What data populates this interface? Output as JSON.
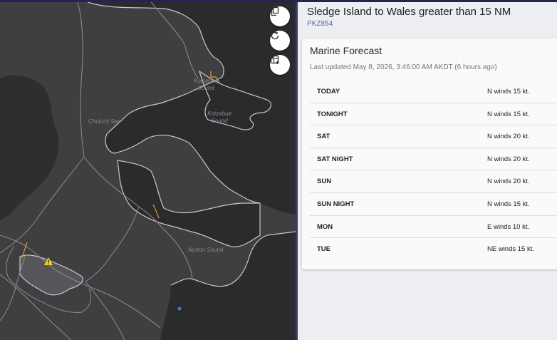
{
  "map": {
    "labels": {
      "chukchi_sea": "Chukchi Sea",
      "kotzebue_sound_1": "Kotzebue Sound",
      "kotzebue_sound_2": "Kotzebue Sound",
      "norton_sound": "Norton Sound"
    },
    "buttons": {
      "copy": "copy-icon",
      "refresh": "refresh-icon",
      "layers": "table-add-icon"
    },
    "colors": {
      "water": "#3f3f41",
      "land": "#2b2b2e",
      "coast": "#c8c8cc",
      "zone_lines": "#8e8e92",
      "river": "#e39a2b",
      "warning": "#f1d51b"
    }
  },
  "panel": {
    "zone_title": "Sledge Island to Wales greater than 15 NM",
    "zone_id": "PKZ854",
    "forecast": {
      "title": "Marine Forecast",
      "updated": "Last updated May 8, 2026, 3:46:00 AM AKDT (6 hours ago)",
      "periods": [
        {
          "name": "TODAY",
          "text": "N winds 15 kt."
        },
        {
          "name": "TONIGHT",
          "text": "N winds 15 kt."
        },
        {
          "name": "SAT",
          "text": "N winds 20 kt."
        },
        {
          "name": "SAT NIGHT",
          "text": "N winds 20 kt."
        },
        {
          "name": "SUN",
          "text": "N winds 20 kt."
        },
        {
          "name": "SUN NIGHT",
          "text": "N winds 15 kt."
        },
        {
          "name": "MON",
          "text": "E winds 10 kt."
        },
        {
          "name": "TUE",
          "text": "NE winds 15 kt."
        }
      ]
    }
  }
}
